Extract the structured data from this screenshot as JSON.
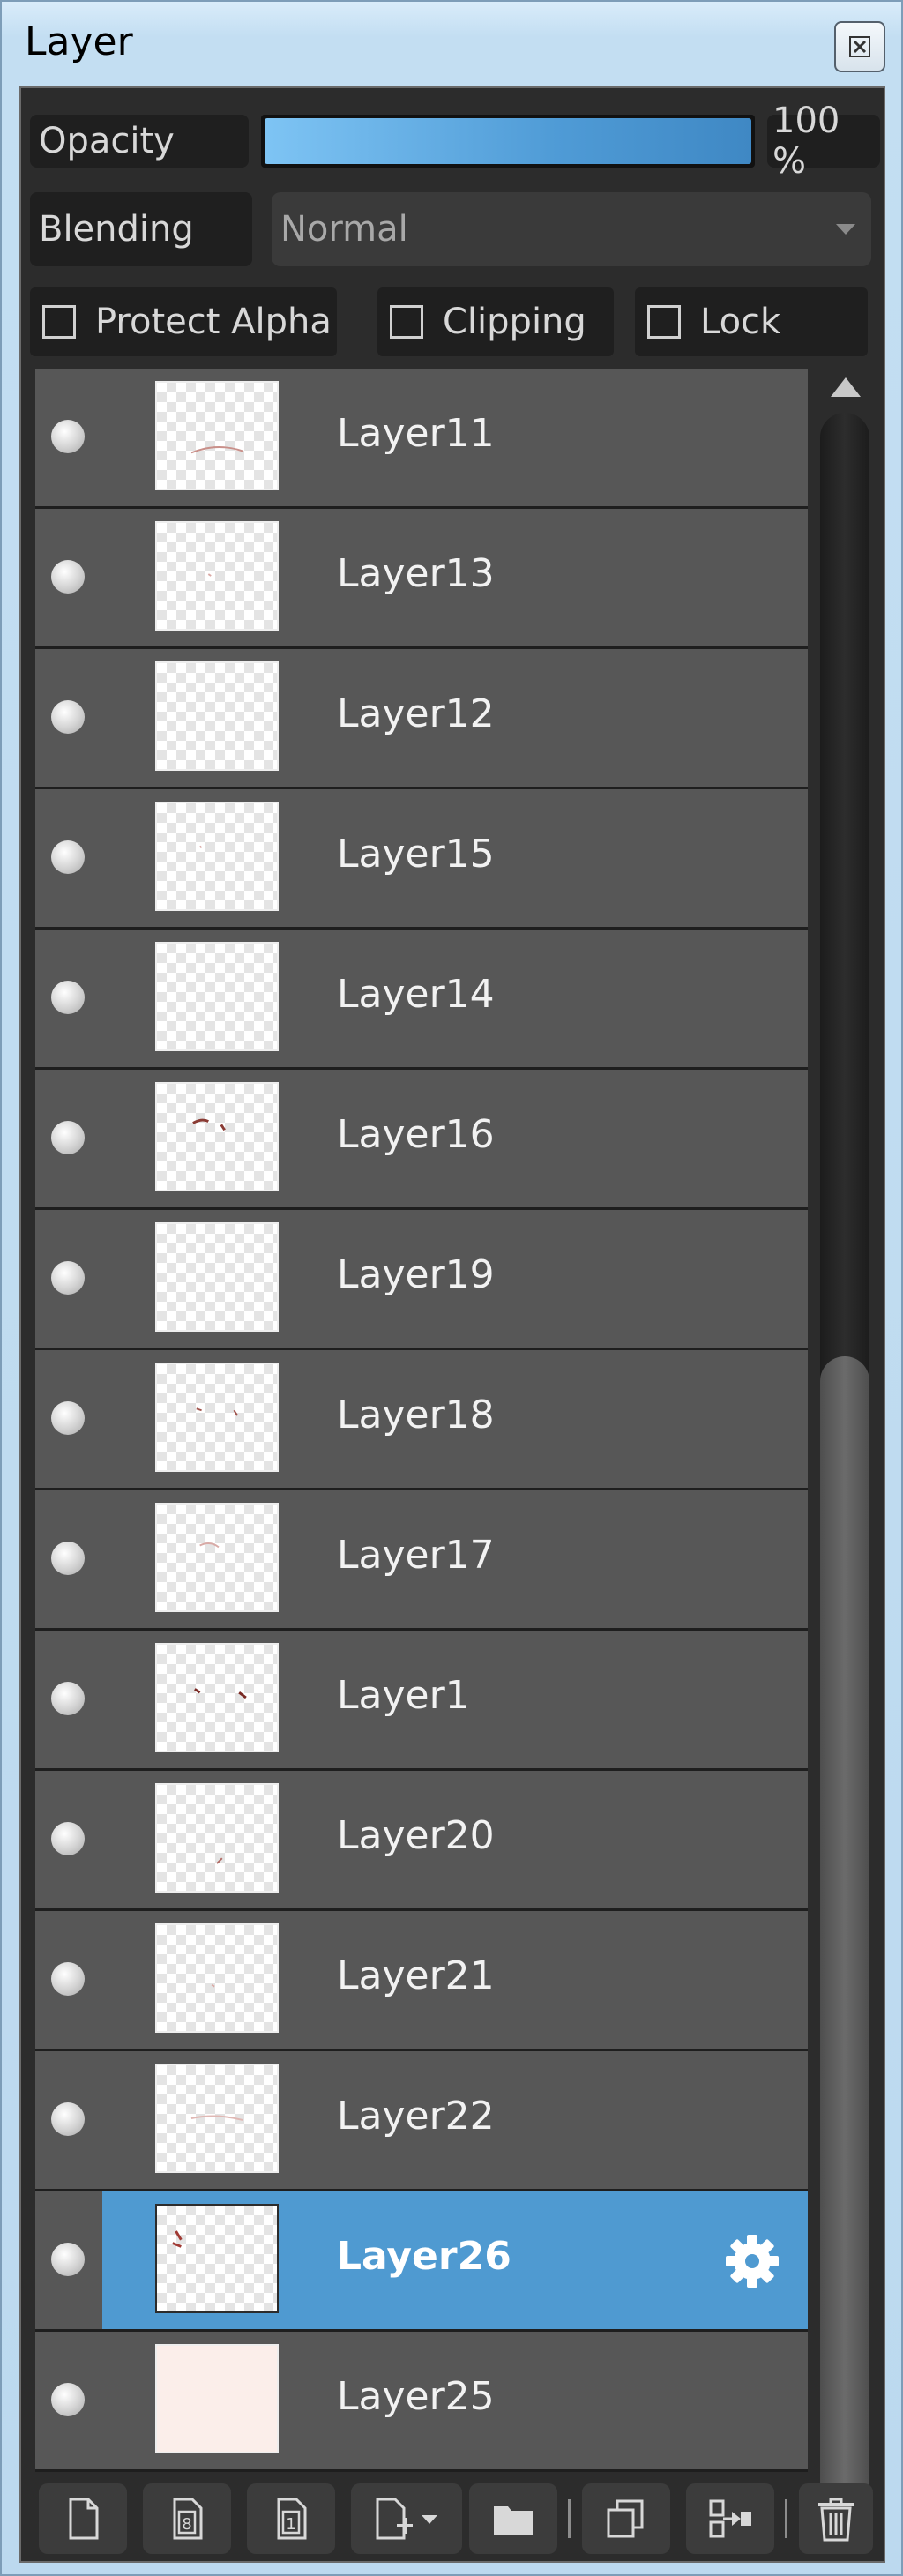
{
  "window": {
    "title": "Layer"
  },
  "opacity": {
    "label": "Opacity",
    "value_text": "100 %",
    "value": 100
  },
  "blending": {
    "label": "Blending",
    "selected": "Normal"
  },
  "options": {
    "protect_alpha": {
      "label": "Protect Alpha",
      "checked": false
    },
    "clipping": {
      "label": "Clipping",
      "checked": false
    },
    "lock": {
      "label": "Lock",
      "checked": false
    }
  },
  "layers": [
    {
      "name": "Layer11",
      "visible": true,
      "selected": false
    },
    {
      "name": "Layer13",
      "visible": true,
      "selected": false
    },
    {
      "name": "Layer12",
      "visible": true,
      "selected": false
    },
    {
      "name": "Layer15",
      "visible": true,
      "selected": false
    },
    {
      "name": "Layer14",
      "visible": true,
      "selected": false
    },
    {
      "name": "Layer16",
      "visible": true,
      "selected": false
    },
    {
      "name": "Layer19",
      "visible": true,
      "selected": false
    },
    {
      "name": "Layer18",
      "visible": true,
      "selected": false
    },
    {
      "name": "Layer17",
      "visible": true,
      "selected": false
    },
    {
      "name": "Layer1",
      "visible": true,
      "selected": false
    },
    {
      "name": "Layer20",
      "visible": true,
      "selected": false
    },
    {
      "name": "Layer21",
      "visible": true,
      "selected": false
    },
    {
      "name": "Layer22",
      "visible": true,
      "selected": false
    },
    {
      "name": "Layer26",
      "visible": true,
      "selected": true
    },
    {
      "name": "Layer25",
      "visible": true,
      "selected": false
    }
  ],
  "toolbar": {
    "buttons": [
      "new-layer-icon",
      "new-8bit-layer-icon",
      "new-1bit-layer-icon",
      "add-layer-menu-icon",
      "new-folder-icon",
      "duplicate-layer-icon",
      "merge-down-icon",
      "delete-layer-icon"
    ]
  },
  "colors": {
    "selection": "#4f9ad1",
    "row_bg": "#575757",
    "panel_bg": "#2c2c2c",
    "accent": "#4f9bd6"
  }
}
